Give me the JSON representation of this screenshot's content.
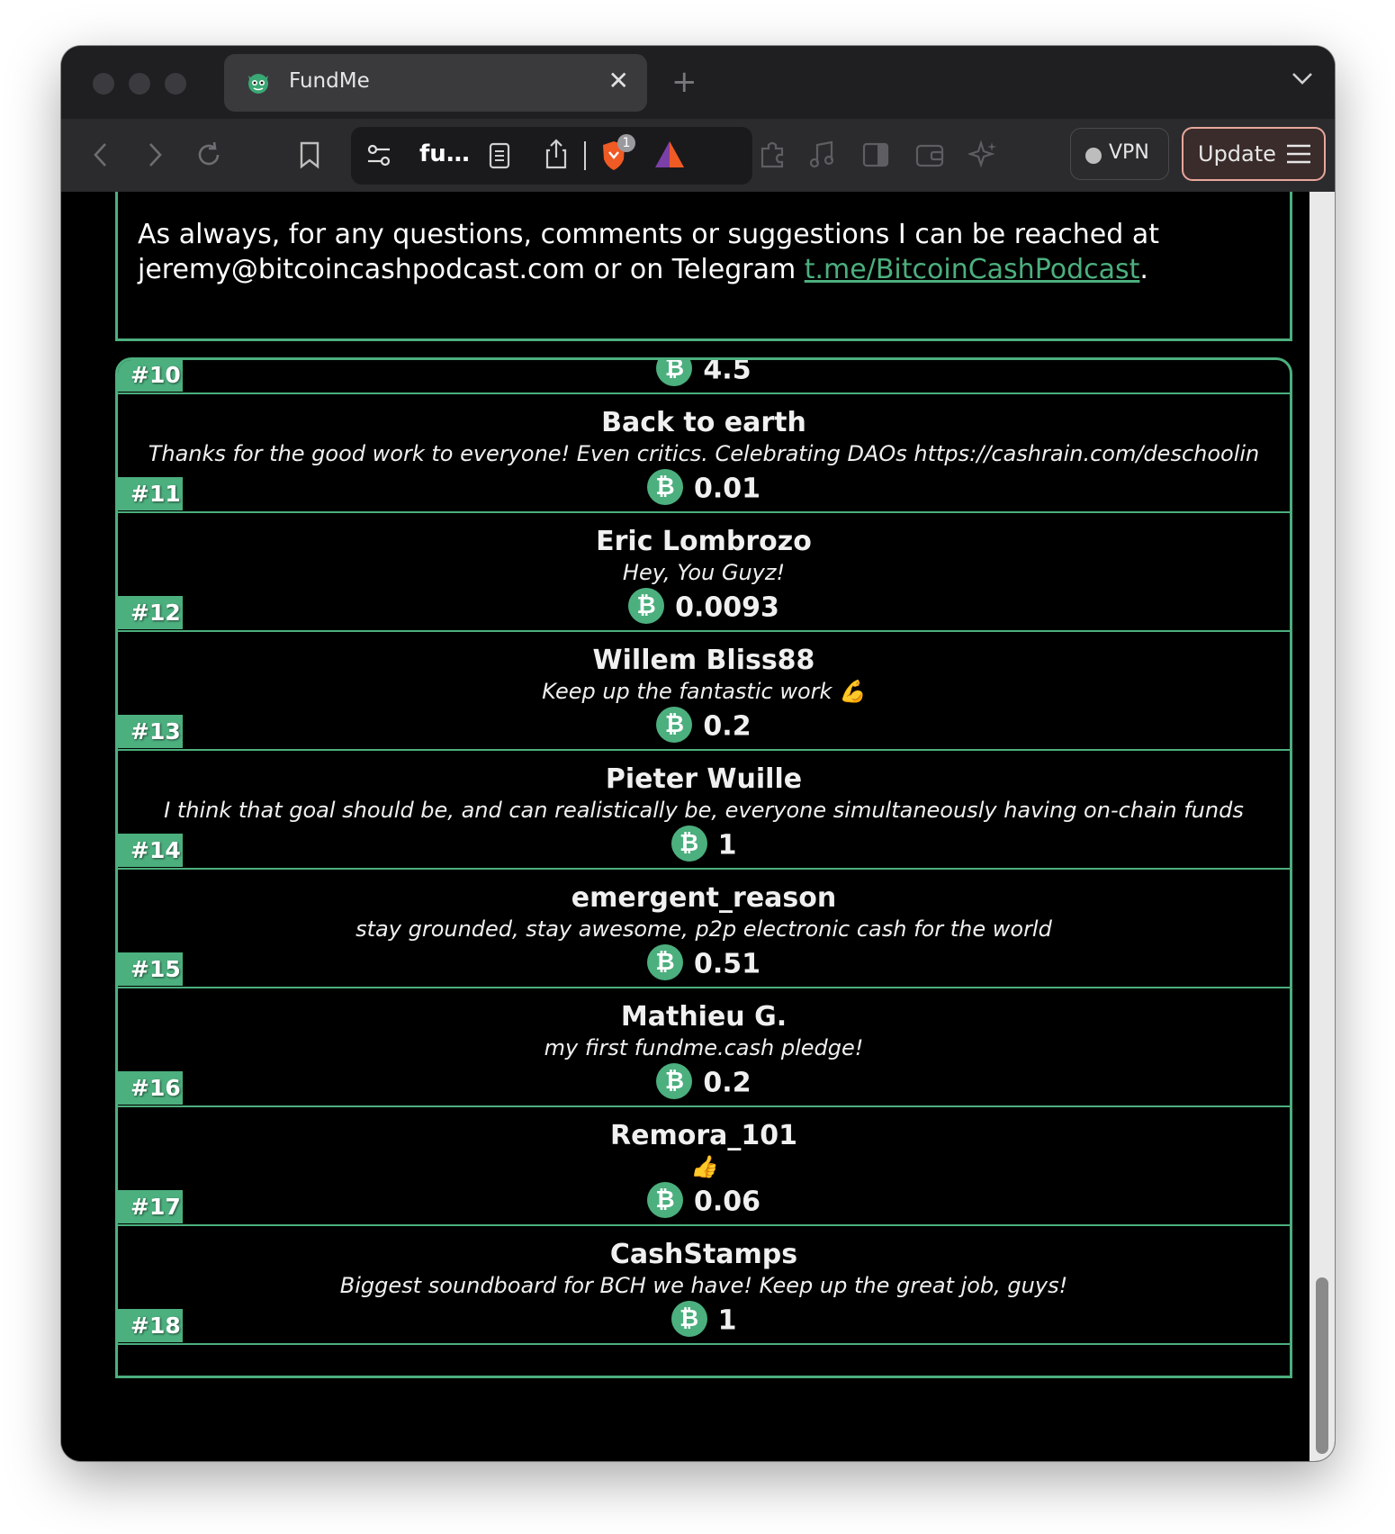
{
  "browser": {
    "tab_title": "FundMe",
    "tab_close": "✕",
    "new_tab": "+",
    "url_text": "fu…",
    "shield_badge": "1",
    "vpn_label": "VPN",
    "update_label": "Update"
  },
  "info": {
    "text": "As always, for any questions, comments or suggestions I can be reached at jeremy@bitcoincashpodcast.com or on Telegram ",
    "link": "t.me/BitcoinCashPodcast",
    "after": "."
  },
  "currency_glyph": "₿",
  "pledges": [
    {
      "rank": "#10",
      "name": "",
      "message": "",
      "amount": "4.5"
    },
    {
      "rank": "#11",
      "name": "Back to earth",
      "message": "Thanks for the good work to everyone! Even critics. Celebrating DAOs https://cashrain.com/deschoolin",
      "amount": "0.01"
    },
    {
      "rank": "#12",
      "name": "Eric Lombrozo",
      "message": "Hey, You Guyz!",
      "amount": "0.0093"
    },
    {
      "rank": "#13",
      "name": "Willem Bliss88",
      "message": "Keep up the fantastic work 💪",
      "amount": "0.2"
    },
    {
      "rank": "#14",
      "name": "Pieter Wuille",
      "message": "I think that goal should be, and can realistically be, everyone simultaneously having on-chain funds",
      "amount": "1"
    },
    {
      "rank": "#15",
      "name": "emergent_reason",
      "message": "stay grounded, stay awesome, p2p electronic cash for the world",
      "amount": "0.51"
    },
    {
      "rank": "#16",
      "name": "Mathieu G.",
      "message": "my first fundme.cash pledge!",
      "amount": "0.2"
    },
    {
      "rank": "#17",
      "name": "Remora_101",
      "message": "👍",
      "amount": "0.06"
    },
    {
      "rank": "#18",
      "name": "CashStamps",
      "message": "Biggest soundboard for BCH we have! Keep up the great job, guys!",
      "amount": "1"
    }
  ]
}
